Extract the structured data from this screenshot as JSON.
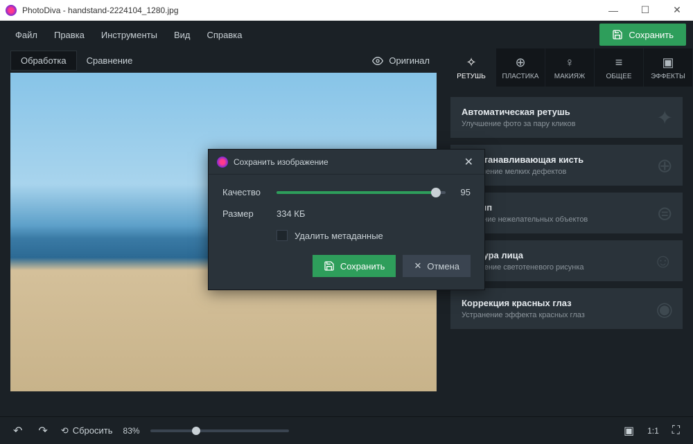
{
  "app_name": "PhotoDiva",
  "file_name": "handstand-2224104_1280.jpg",
  "titlebar_text": "PhotoDiva - handstand-2224104_1280.jpg",
  "menu": {
    "file": "Файл",
    "edit": "Правка",
    "tools": "Инструменты",
    "view": "Вид",
    "help": "Справка"
  },
  "save_button": "Сохранить",
  "tabs": {
    "process": "Обработка",
    "compare": "Сравнение"
  },
  "original_button": "Оригинал",
  "tool_tabs": [
    {
      "key": "retouch",
      "label": "РЕТУШЬ",
      "active": true
    },
    {
      "key": "plastic",
      "label": "ПЛАСТИКА",
      "active": false
    },
    {
      "key": "makeup",
      "label": "МАКИЯЖ",
      "active": false
    },
    {
      "key": "general",
      "label": "ОБЩЕЕ",
      "active": false
    },
    {
      "key": "effects",
      "label": "ЭФФЕКТЫ",
      "active": false
    }
  ],
  "panels": [
    {
      "title": "Автоматическая ретушь",
      "sub": "Улучшение фото за пару кликов",
      "icon": "✦"
    },
    {
      "title": "Восстанавливающая кисть",
      "sub": "Устранение мелких дефектов",
      "icon": "⊕"
    },
    {
      "title": "Штамп",
      "sub": "Удаление нежелательных объектов",
      "icon": "⊜"
    },
    {
      "title": "Фактура лица",
      "sub": "Улучшение светотеневого рисунка",
      "icon": "☺"
    },
    {
      "title": "Коррекция красных глаз",
      "sub": "Устранение эффекта красных глаз",
      "icon": "◉"
    }
  ],
  "bottom": {
    "reset": "Сбросить",
    "zoom": "83%",
    "ratio": "1:1"
  },
  "dialog": {
    "title": "Сохранить изображение",
    "quality_label": "Качество",
    "quality_value": "95",
    "size_label": "Размер",
    "size_value": "334 КБ",
    "delete_meta": "Удалить метаданные",
    "save": "Сохранить",
    "cancel": "Отмена"
  }
}
